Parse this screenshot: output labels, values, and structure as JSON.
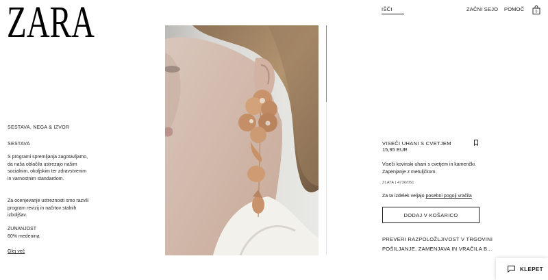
{
  "brand": {
    "logo_text": "ZARA"
  },
  "header": {
    "search_label": "IŠČI",
    "login_label": "ZAČNI SEJO",
    "help_label": "POMOČ",
    "bag_icon": "shopping-bag-icon"
  },
  "composition": {
    "title": "SESTAVA, NEGA & IZVOR",
    "subtitle": "SESTAVA",
    "paragraph1": "S programi spremljanja zagotavljamo, da naša oblačila ustrezajo našim socialnim, okoljskim ter zdravstvenim in varnostnim standardom.",
    "paragraph2": "Za ocenjevanje ustreznosti smo razvili program revizij in načrtov stalnih izboljšav.",
    "outer_label": "ZUNANJOST",
    "outer_value": "60% medenina",
    "more_link": "Glej več"
  },
  "product": {
    "name": "VISEČI UHANI S CVETJEM",
    "price": "15,95 EUR",
    "description": "Viseči kovinski uhani s cvetjem in kamenčki. Zapenjanje z metuljčkom.",
    "color_ref": "ZLATA | 4736/051",
    "returns_prefix": "Za ta izdelek veljajo",
    "returns_link": "posebni pogoji vračila",
    "add_button": "DODAJ V KOŠARICO",
    "store_link": "PREVERI RAZPOLOŽLJIVOST V TRGOVINI",
    "shipping_link": "POŠILJANJE, ZAMENJAVA IN VRAČILA B...",
    "bookmark_icon": "bookmark-icon"
  },
  "chat": {
    "label": "KLEPET",
    "icon": "chat-bubble-icon"
  },
  "colors": {
    "text": "#1a1a1a",
    "background": "#ffffff",
    "earring_gold": "#c9946b"
  }
}
